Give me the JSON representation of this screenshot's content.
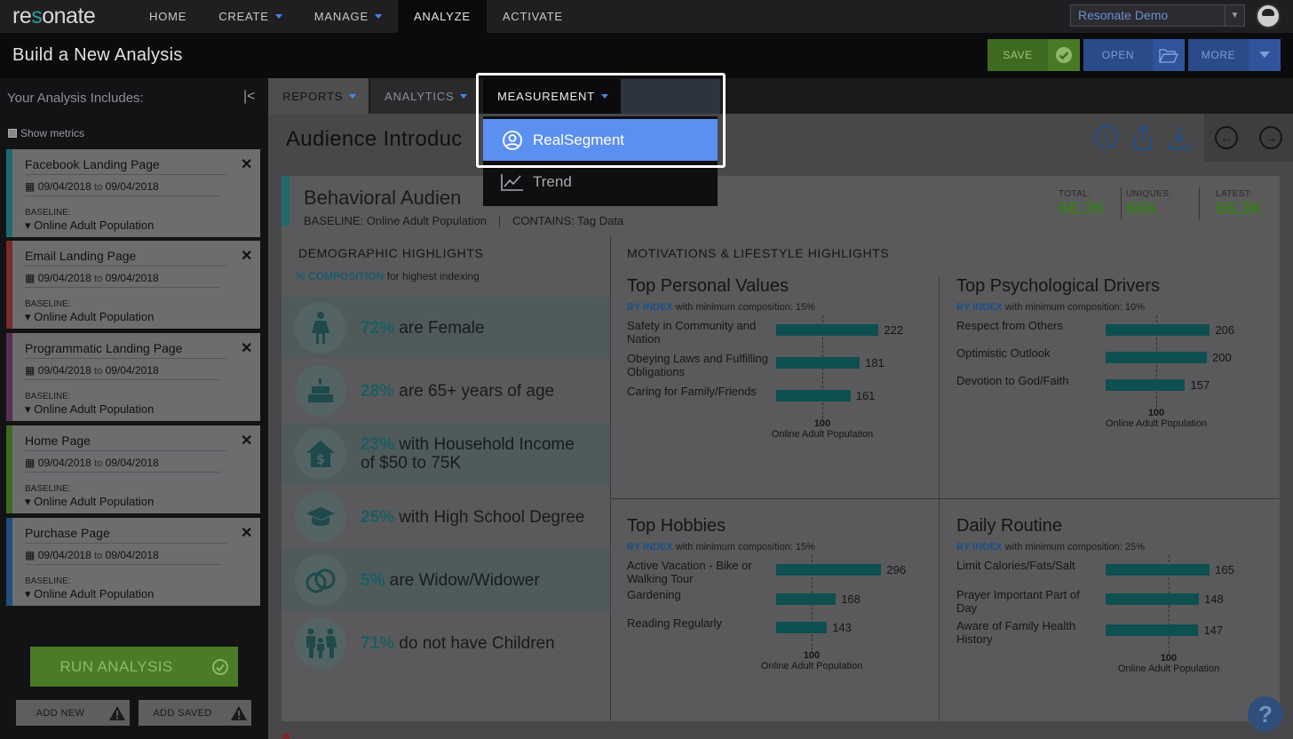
{
  "topnav": {
    "logo": [
      "re",
      "s",
      "onate"
    ],
    "items": [
      {
        "label": "HOME",
        "caret": false
      },
      {
        "label": "CREATE",
        "caret": true
      },
      {
        "label": "MANAGE",
        "caret": true
      },
      {
        "label": "ANALYZE",
        "caret": false,
        "active": true
      },
      {
        "label": "ACTIVATE",
        "caret": false
      }
    ],
    "account_select": "Resonate Demo"
  },
  "titlebar": {
    "title": "Build a New Analysis",
    "save_label": "SAVE",
    "open_label": "OPEN",
    "more_label": "MORE"
  },
  "sidebar": {
    "heading": "Your Analysis Includes:",
    "show_metrics": "Show metrics",
    "cards": [
      {
        "name": "Facebook Landing Page",
        "start": "09/04/2018",
        "to": "to",
        "end": "09/04/2018",
        "baseline_label": "BASELINE:",
        "baseline": "Online Adult Population",
        "color": "#1c6b6a"
      },
      {
        "name": "Email Landing Page",
        "start": "09/04/2018",
        "to": "to",
        "end": "09/04/2018",
        "baseline_label": "BASELINE:",
        "baseline": "Online Adult Population",
        "color": "#7a2a2a"
      },
      {
        "name": "Programmatic Landing Page",
        "start": "09/04/2018",
        "to": "to",
        "end": "09/04/2018",
        "baseline_label": "BASELINE:",
        "baseline": "Online Adult Population",
        "color": "#5a3050"
      },
      {
        "name": "Home Page",
        "start": "09/04/2018",
        "to": "to",
        "end": "09/04/2018",
        "baseline_label": "BASELINE:",
        "baseline": "Online Adult Population",
        "color": "#3d6a1f"
      },
      {
        "name": "Purchase Page",
        "start": "09/04/2018",
        "to": "to",
        "end": "09/04/2018",
        "baseline_label": "BASELINE:",
        "baseline": "Online Adult Population",
        "color": "#1f4f7a"
      }
    ],
    "run_label": "RUN ANALYSIS",
    "add_new_label": "ADD NEW",
    "add_saved_label": "ADD SAVED"
  },
  "tabs": {
    "reports": "REPORTS",
    "analytics": "ANALYTICS",
    "measurement": "MEASUREMENT"
  },
  "dropdown": {
    "items": [
      {
        "label": "RealSegment",
        "icon": "user-circle-icon",
        "selected": true
      },
      {
        "label": "Trend",
        "icon": "trend-chart-icon",
        "selected": false
      }
    ]
  },
  "report": {
    "title": "Audience Introduc",
    "panel_title": "Behavioral Audien",
    "baseline": "BASELINE: Online Adult Population",
    "contains": "CONTAINS: Tag Data",
    "stats": [
      {
        "label": "TOTAL:",
        "value": "66.3K"
      },
      {
        "label": "UNIQUES:",
        "value": "66K"
      },
      {
        "label": "LATEST:",
        "value": "66.3K"
      }
    ],
    "demographic": {
      "heading": "DEMOGRAPHIC HIGHLIGHTS",
      "sub_hl": "% COMPOSITION",
      "sub_rest": " for highest indexing",
      "rows": [
        {
          "pct": "72%",
          "text": " are Female",
          "icon": "female-icon"
        },
        {
          "pct": "28%",
          "text": " are 65+ years of age",
          "icon": "cake-icon"
        },
        {
          "pct": "23%",
          "text": " with Household Income of $50 to 75K",
          "icon": "house-dollar-icon"
        },
        {
          "pct": "25%",
          "text": " with High School Degree",
          "icon": "graduation-cap-icon"
        },
        {
          "pct": "5%",
          "text": " are Widow/Widower",
          "icon": "rings-icon"
        },
        {
          "pct": "71%",
          "text": " do not have Children",
          "icon": "family-icon"
        }
      ]
    },
    "motivations_heading": "MOTIVATIONS & LIFESTYLE HIGHLIGHTS",
    "axis_value": "100",
    "axis_label": "Online Adult Population",
    "by_index": "BY INDEX",
    "quadrants": [
      {
        "title": "Top Personal Values",
        "min": " with minimum composition: 15%",
        "bars": [
          {
            "label": "Safety in Community and Nation",
            "value": 222
          },
          {
            "label": "Obeying Laws and Fulfilling Obligations",
            "value": 181
          },
          {
            "label": "Caring for Family/Friends",
            "value": 161
          }
        ]
      },
      {
        "title": "Top Psychological Drivers",
        "min": " with minimum composition: 10%",
        "bars": [
          {
            "label": "Respect from Others",
            "value": 206
          },
          {
            "label": "Optimistic Outlook",
            "value": 200
          },
          {
            "label": "Devotion to God/Faith",
            "value": 157
          }
        ]
      },
      {
        "title": "Top Hobbies",
        "min": " with minimum composition: 15%",
        "bars": [
          {
            "label": "Active Vacation - Bike or Walking Tour",
            "value": 296
          },
          {
            "label": "Gardening",
            "value": 168
          },
          {
            "label": "Reading Regularly",
            "value": 143
          }
        ]
      },
      {
        "title": "Daily Routine",
        "min": " with minimum composition: 25%",
        "bars": [
          {
            "label": "Limit Calories/Fats/Salt",
            "value": 165
          },
          {
            "label": "Prayer Important Part of Day",
            "value": 148
          },
          {
            "label": "Aware of Family Health History",
            "value": 147
          }
        ]
      }
    ]
  },
  "help_label": "?"
}
